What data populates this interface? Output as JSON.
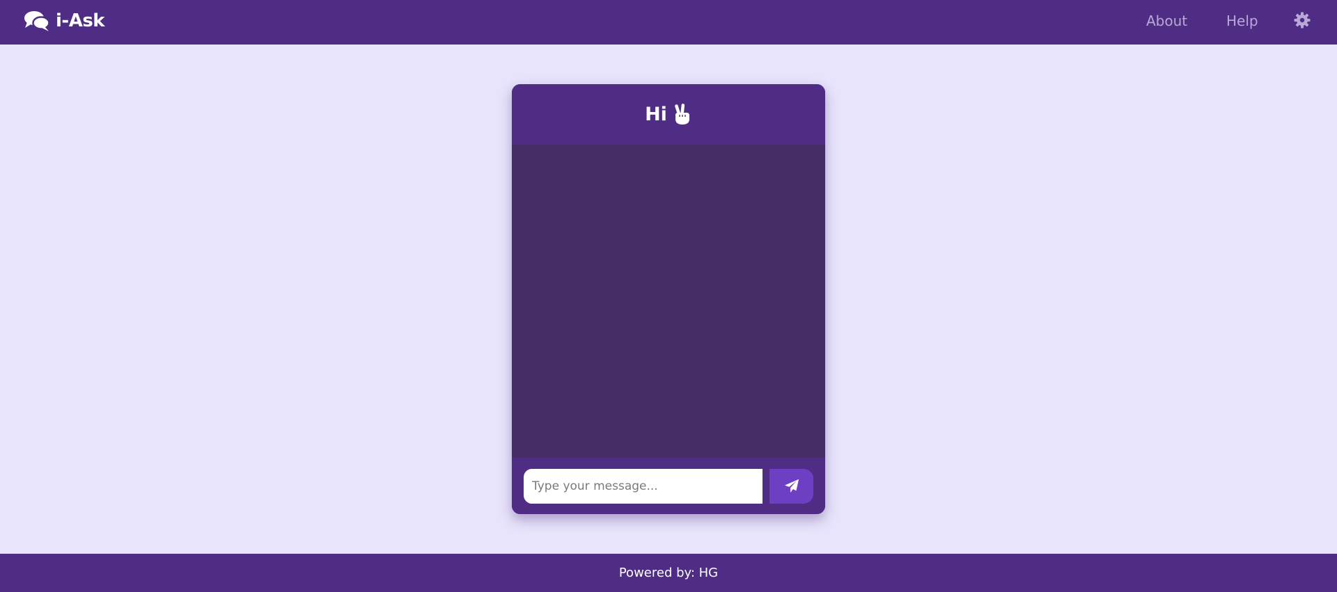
{
  "navbar": {
    "brand_icon": "comments-icon",
    "brand_name": "i-Ask",
    "links": [
      {
        "label": "About"
      },
      {
        "label": "Help"
      }
    ],
    "settings_icon": "gear-icon"
  },
  "chat": {
    "title": "Hi",
    "title_icon": "peace-hand-icon",
    "messages": [],
    "input": {
      "value": "",
      "placeholder": "Type your message..."
    },
    "send_icon": "paper-plane-icon"
  },
  "footer": {
    "text": "Powered by: HG"
  },
  "colors": {
    "primary": "#4f2d85",
    "page_background": "#e8e4fc",
    "messages_background": "#452d66",
    "send_button": "#6d3fc3",
    "nav_link": "#b9a8d8"
  }
}
